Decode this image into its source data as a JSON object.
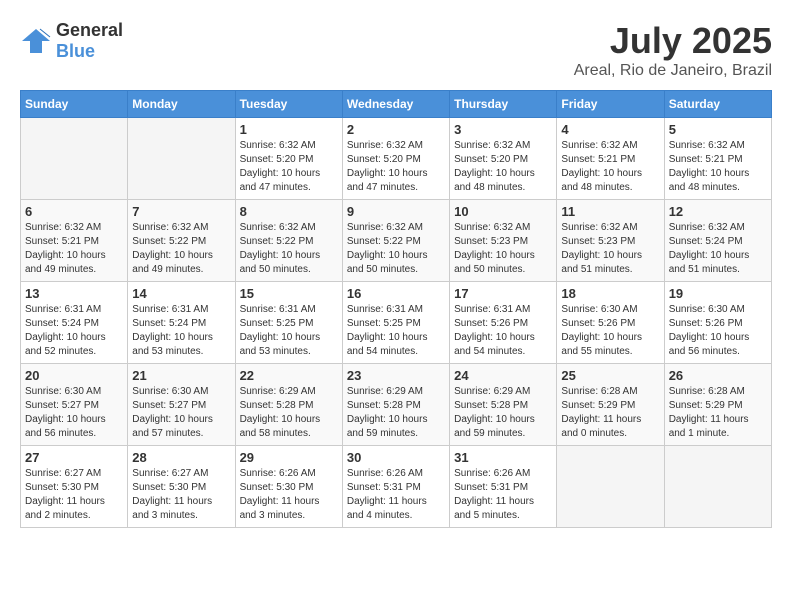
{
  "logo": {
    "general": "General",
    "blue": "Blue"
  },
  "header": {
    "month": "July 2025",
    "location": "Areal, Rio de Janeiro, Brazil"
  },
  "weekdays": [
    "Sunday",
    "Monday",
    "Tuesday",
    "Wednesday",
    "Thursday",
    "Friday",
    "Saturday"
  ],
  "weeks": [
    [
      {
        "day": "",
        "info": ""
      },
      {
        "day": "",
        "info": ""
      },
      {
        "day": "1",
        "info": "Sunrise: 6:32 AM\nSunset: 5:20 PM\nDaylight: 10 hours and 47 minutes."
      },
      {
        "day": "2",
        "info": "Sunrise: 6:32 AM\nSunset: 5:20 PM\nDaylight: 10 hours and 47 minutes."
      },
      {
        "day": "3",
        "info": "Sunrise: 6:32 AM\nSunset: 5:20 PM\nDaylight: 10 hours and 48 minutes."
      },
      {
        "day": "4",
        "info": "Sunrise: 6:32 AM\nSunset: 5:21 PM\nDaylight: 10 hours and 48 minutes."
      },
      {
        "day": "5",
        "info": "Sunrise: 6:32 AM\nSunset: 5:21 PM\nDaylight: 10 hours and 48 minutes."
      }
    ],
    [
      {
        "day": "6",
        "info": "Sunrise: 6:32 AM\nSunset: 5:21 PM\nDaylight: 10 hours and 49 minutes."
      },
      {
        "day": "7",
        "info": "Sunrise: 6:32 AM\nSunset: 5:22 PM\nDaylight: 10 hours and 49 minutes."
      },
      {
        "day": "8",
        "info": "Sunrise: 6:32 AM\nSunset: 5:22 PM\nDaylight: 10 hours and 50 minutes."
      },
      {
        "day": "9",
        "info": "Sunrise: 6:32 AM\nSunset: 5:22 PM\nDaylight: 10 hours and 50 minutes."
      },
      {
        "day": "10",
        "info": "Sunrise: 6:32 AM\nSunset: 5:23 PM\nDaylight: 10 hours and 50 minutes."
      },
      {
        "day": "11",
        "info": "Sunrise: 6:32 AM\nSunset: 5:23 PM\nDaylight: 10 hours and 51 minutes."
      },
      {
        "day": "12",
        "info": "Sunrise: 6:32 AM\nSunset: 5:24 PM\nDaylight: 10 hours and 51 minutes."
      }
    ],
    [
      {
        "day": "13",
        "info": "Sunrise: 6:31 AM\nSunset: 5:24 PM\nDaylight: 10 hours and 52 minutes."
      },
      {
        "day": "14",
        "info": "Sunrise: 6:31 AM\nSunset: 5:24 PM\nDaylight: 10 hours and 53 minutes."
      },
      {
        "day": "15",
        "info": "Sunrise: 6:31 AM\nSunset: 5:25 PM\nDaylight: 10 hours and 53 minutes."
      },
      {
        "day": "16",
        "info": "Sunrise: 6:31 AM\nSunset: 5:25 PM\nDaylight: 10 hours and 54 minutes."
      },
      {
        "day": "17",
        "info": "Sunrise: 6:31 AM\nSunset: 5:26 PM\nDaylight: 10 hours and 54 minutes."
      },
      {
        "day": "18",
        "info": "Sunrise: 6:30 AM\nSunset: 5:26 PM\nDaylight: 10 hours and 55 minutes."
      },
      {
        "day": "19",
        "info": "Sunrise: 6:30 AM\nSunset: 5:26 PM\nDaylight: 10 hours and 56 minutes."
      }
    ],
    [
      {
        "day": "20",
        "info": "Sunrise: 6:30 AM\nSunset: 5:27 PM\nDaylight: 10 hours and 56 minutes."
      },
      {
        "day": "21",
        "info": "Sunrise: 6:30 AM\nSunset: 5:27 PM\nDaylight: 10 hours and 57 minutes."
      },
      {
        "day": "22",
        "info": "Sunrise: 6:29 AM\nSunset: 5:28 PM\nDaylight: 10 hours and 58 minutes."
      },
      {
        "day": "23",
        "info": "Sunrise: 6:29 AM\nSunset: 5:28 PM\nDaylight: 10 hours and 59 minutes."
      },
      {
        "day": "24",
        "info": "Sunrise: 6:29 AM\nSunset: 5:28 PM\nDaylight: 10 hours and 59 minutes."
      },
      {
        "day": "25",
        "info": "Sunrise: 6:28 AM\nSunset: 5:29 PM\nDaylight: 11 hours and 0 minutes."
      },
      {
        "day": "26",
        "info": "Sunrise: 6:28 AM\nSunset: 5:29 PM\nDaylight: 11 hours and 1 minute."
      }
    ],
    [
      {
        "day": "27",
        "info": "Sunrise: 6:27 AM\nSunset: 5:30 PM\nDaylight: 11 hours and 2 minutes."
      },
      {
        "day": "28",
        "info": "Sunrise: 6:27 AM\nSunset: 5:30 PM\nDaylight: 11 hours and 3 minutes."
      },
      {
        "day": "29",
        "info": "Sunrise: 6:26 AM\nSunset: 5:30 PM\nDaylight: 11 hours and 3 minutes."
      },
      {
        "day": "30",
        "info": "Sunrise: 6:26 AM\nSunset: 5:31 PM\nDaylight: 11 hours and 4 minutes."
      },
      {
        "day": "31",
        "info": "Sunrise: 6:26 AM\nSunset: 5:31 PM\nDaylight: 11 hours and 5 minutes."
      },
      {
        "day": "",
        "info": ""
      },
      {
        "day": "",
        "info": ""
      }
    ]
  ]
}
